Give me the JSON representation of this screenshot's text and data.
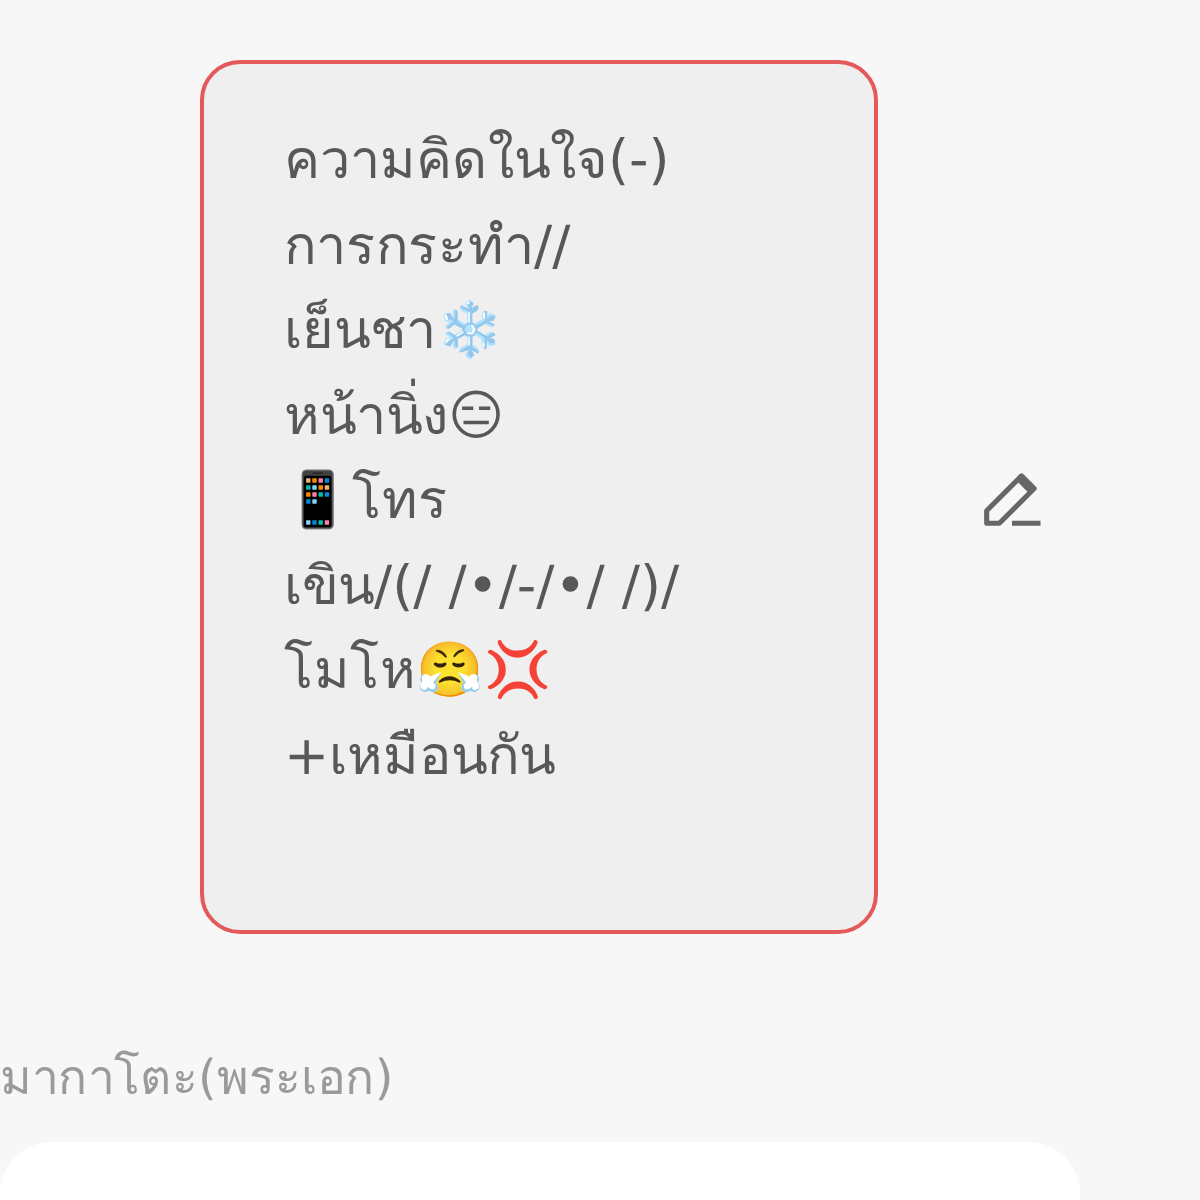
{
  "note_lines": [
    "ความคิดในใจ(-)",
    "การกระทำ//",
    "เย็นชา❄️",
    "หน้านิ่ง😑",
    "📱โทร",
    "เขิน/(/ /•/-/•/ /)/",
    "โมโห😤💢",
    "+เหมือนกัน"
  ],
  "caption": "มากาโตะ(พระเอก)"
}
